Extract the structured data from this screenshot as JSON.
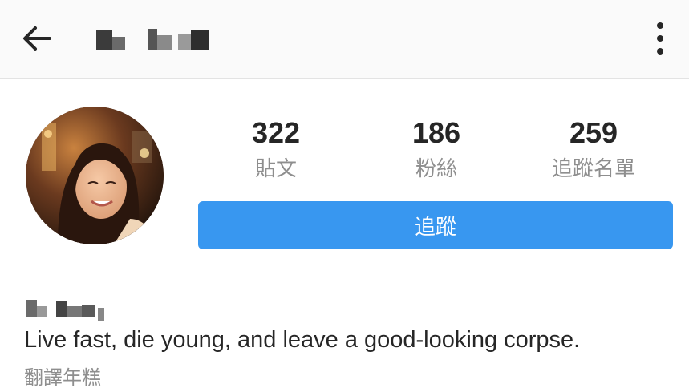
{
  "header": {
    "back_icon": "arrow-left-icon",
    "username_redacted": true,
    "more_icon": "vertical-ellipsis-icon"
  },
  "profile": {
    "avatar_icon": "profile-photo",
    "stats": [
      {
        "value": "322",
        "label": "貼文"
      },
      {
        "value": "186",
        "label": "粉絲"
      },
      {
        "value": "259",
        "label": "追蹤名單"
      }
    ],
    "follow_button_label": "追蹤",
    "name_redacted": true,
    "bio": "Live fast, die young, and leave a good-looking corpse.",
    "translate_label": "翻譯年糕"
  },
  "colors": {
    "accent": "#3897f0",
    "text": "#262626",
    "muted": "#8e8e8e",
    "header_bg": "#fafafa"
  }
}
